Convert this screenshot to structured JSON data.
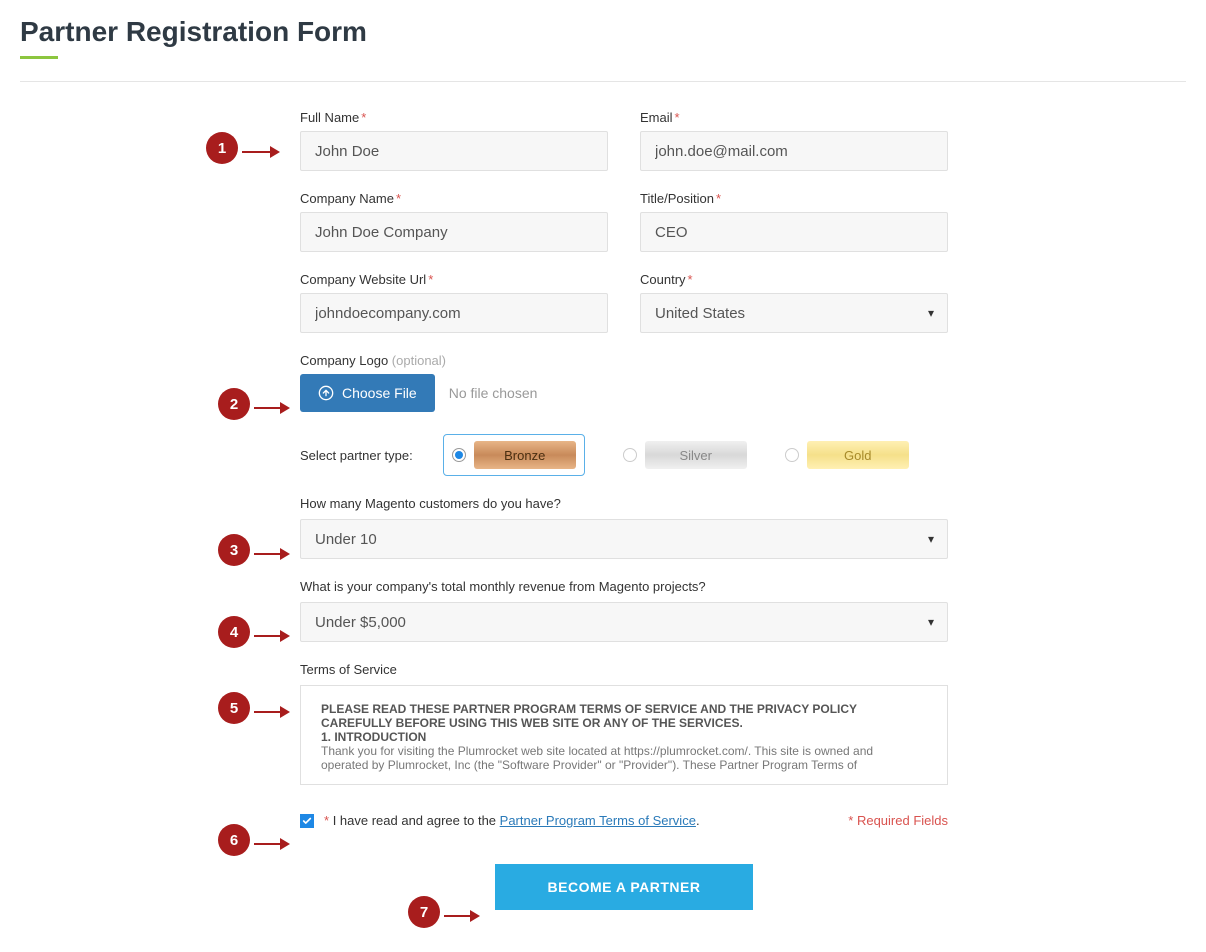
{
  "page": {
    "title": "Partner Registration Form"
  },
  "fields": {
    "fullname": {
      "label": "Full Name",
      "value": "John Doe"
    },
    "email": {
      "label": "Email",
      "value": "john.doe@mail.com"
    },
    "company": {
      "label": "Company Name",
      "value": "John Doe Company"
    },
    "title": {
      "label": "Title/Position",
      "value": "CEO"
    },
    "website": {
      "label": "Company Website Url",
      "value": "johndoecompany.com"
    },
    "country": {
      "label": "Country",
      "value": "United States"
    },
    "logo": {
      "label": "Company Logo",
      "optional": "(optional)",
      "button": "Choose File",
      "status": "No file chosen"
    },
    "partnerType": {
      "label": "Select partner type:",
      "options": [
        "Bronze",
        "Silver",
        "Gold"
      ],
      "selected": "Bronze"
    },
    "customers": {
      "label": "How many Magento customers do you have?",
      "value": "Under 10"
    },
    "revenue": {
      "label": "What is your company's total monthly revenue from Magento projects?",
      "value": "Under $5,000"
    },
    "tos": {
      "label": "Terms of Service",
      "line1": "PLEASE READ THESE PARTNER PROGRAM TERMS OF SERVICE AND THE PRIVACY POLICY CAREFULLY BEFORE USING THIS WEB SITE OR ANY OF THE SERVICES.",
      "line2": "1. INTRODUCTION",
      "line3": "Thank you for visiting the Plumrocket web site located at https://plumrocket.com/. This site is owned and operated by Plumrocket, Inc (the \"Software Provider\" or \"Provider\"). These Partner Program Terms of"
    },
    "agree": {
      "prefix": "I have read and agree to the ",
      "link": "Partner Program Terms of Service",
      "suffix": "."
    },
    "requiredNote": "* Required Fields",
    "submit": "BECOME A PARTNER"
  },
  "annotations": [
    "1",
    "2",
    "3",
    "4",
    "5",
    "6",
    "7"
  ]
}
